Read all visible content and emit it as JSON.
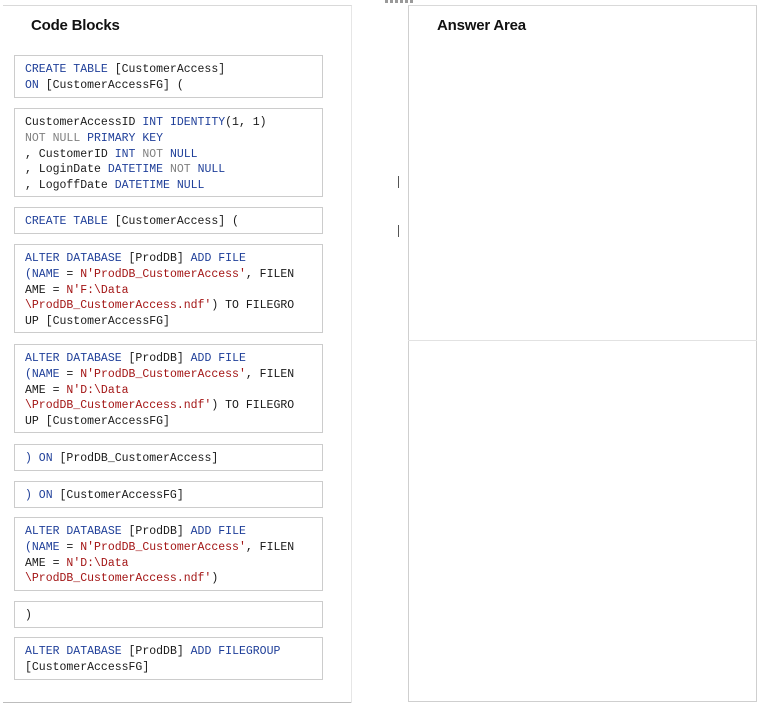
{
  "code_blocks_panel": {
    "title": "Code Blocks",
    "blocks": [
      {
        "lines": [
          [
            {
              "t": "CREATE TABLE ",
              "c": "kw"
            },
            {
              "t": "[CustomerAccess]",
              "c": "pl"
            }
          ],
          [
            {
              "t": "ON ",
              "c": "kw"
            },
            {
              "t": "[CustomerAccessFG] (",
              "c": "pl"
            }
          ]
        ]
      },
      {
        "lines": [
          [
            {
              "t": "CustomerAccessID ",
              "c": "pl"
            },
            {
              "t": "INT ",
              "c": "kw"
            },
            {
              "t": "IDENTITY",
              "c": "kw"
            },
            {
              "t": "(1, 1)",
              "c": "pl"
            }
          ],
          [
            {
              "t": "NOT ",
              "c": "gr"
            },
            {
              "t": "NULL ",
              "c": "gr"
            },
            {
              "t": "PRIMARY KEY",
              "c": "kw"
            }
          ],
          [
            {
              "t": ", CustomerID ",
              "c": "pl"
            },
            {
              "t": "INT ",
              "c": "kw"
            },
            {
              "t": "NOT ",
              "c": "gr"
            },
            {
              "t": "NULL",
              "c": "kw"
            }
          ],
          [
            {
              "t": ", LoginDate ",
              "c": "pl"
            },
            {
              "t": "DATETIME ",
              "c": "kw"
            },
            {
              "t": "NOT ",
              "c": "gr"
            },
            {
              "t": "NULL",
              "c": "kw"
            }
          ],
          [
            {
              "t": ", LogoffDate ",
              "c": "pl"
            },
            {
              "t": "DATETIME ",
              "c": "kw"
            },
            {
              "t": "NULL",
              "c": "kw"
            }
          ]
        ]
      },
      {
        "lines": [
          [
            {
              "t": "CREATE TABLE ",
              "c": "kw"
            },
            {
              "t": "[CustomerAccess] (",
              "c": "pl"
            }
          ]
        ]
      },
      {
        "lines": [
          [
            {
              "t": "ALTER DATABASE ",
              "c": "kw"
            },
            {
              "t": "[ProdDB] ",
              "c": "pl"
            },
            {
              "t": "ADD FILE",
              "c": "kw"
            }
          ],
          [
            {
              "t": "(NAME ",
              "c": "kw"
            },
            {
              "t": "= ",
              "c": "pl"
            },
            {
              "t": "N'ProdDB_CustomerAccess'",
              "c": "st"
            },
            {
              "t": ", FILEN",
              "c": "pl"
            }
          ],
          [
            {
              "t": "AME = ",
              "c": "pl"
            },
            {
              "t": "N'F:\\Data",
              "c": "st"
            }
          ],
          [
            {
              "t": "\\ProdDB_CustomerAccess.ndf'",
              "c": "st"
            },
            {
              "t": ") TO FILEGRO",
              "c": "pl"
            }
          ],
          [
            {
              "t": "UP [CustomerAccessFG]",
              "c": "pl"
            }
          ]
        ]
      },
      {
        "lines": [
          [
            {
              "t": "ALTER DATABASE ",
              "c": "kw"
            },
            {
              "t": "[ProdDB] ",
              "c": "pl"
            },
            {
              "t": "ADD FILE",
              "c": "kw"
            }
          ],
          [
            {
              "t": "(NAME ",
              "c": "kw"
            },
            {
              "t": "= ",
              "c": "pl"
            },
            {
              "t": "N'ProdDB_CustomerAccess'",
              "c": "st"
            },
            {
              "t": ", FILEN",
              "c": "pl"
            }
          ],
          [
            {
              "t": "AME = ",
              "c": "pl"
            },
            {
              "t": "N'D:\\Data",
              "c": "st"
            }
          ],
          [
            {
              "t": "\\ProdDB_CustomerAccess.ndf'",
              "c": "st"
            },
            {
              "t": ") TO FILEGRO",
              "c": "pl"
            }
          ],
          [
            {
              "t": "UP [CustomerAccessFG]",
              "c": "pl"
            }
          ]
        ]
      },
      {
        "lines": [
          [
            {
              "t": ") ON ",
              "c": "kw"
            },
            {
              "t": "[ProdDB_CustomerAccess]",
              "c": "pl"
            }
          ]
        ]
      },
      {
        "lines": [
          [
            {
              "t": ") ON ",
              "c": "kw"
            },
            {
              "t": "[CustomerAccessFG]",
              "c": "pl"
            }
          ]
        ]
      },
      {
        "lines": [
          [
            {
              "t": "ALTER DATABASE ",
              "c": "kw"
            },
            {
              "t": "[ProdDB] ",
              "c": "pl"
            },
            {
              "t": "ADD FILE",
              "c": "kw"
            }
          ],
          [
            {
              "t": "(NAME ",
              "c": "kw"
            },
            {
              "t": "= ",
              "c": "pl"
            },
            {
              "t": "N'ProdDB_CustomerAccess'",
              "c": "st"
            },
            {
              "t": ", FILEN",
              "c": "pl"
            }
          ],
          [
            {
              "t": "AME = ",
              "c": "pl"
            },
            {
              "t": "N'D:\\Data",
              "c": "st"
            }
          ],
          [
            {
              "t": "\\ProdDB_CustomerAccess.ndf'",
              "c": "st"
            },
            {
              "t": ")",
              "c": "pl"
            }
          ]
        ]
      },
      {
        "lines": [
          [
            {
              "t": ")",
              "c": "pl"
            }
          ]
        ]
      },
      {
        "lines": [
          [
            {
              "t": "ALTER DATABASE ",
              "c": "kw"
            },
            {
              "t": "[ProdDB] ",
              "c": "pl"
            },
            {
              "t": "ADD FILEGROUP",
              "c": "kw"
            }
          ],
          [
            {
              "t": "[CustomerAccessFG]",
              "c": "pl"
            }
          ]
        ]
      }
    ]
  },
  "answer_area_panel": {
    "title": "Answer Area"
  },
  "colors": {
    "keyword": "#1f3f99",
    "gray_keyword": "#808080",
    "string": "#a31515",
    "plain": "#1a1a1a"
  }
}
